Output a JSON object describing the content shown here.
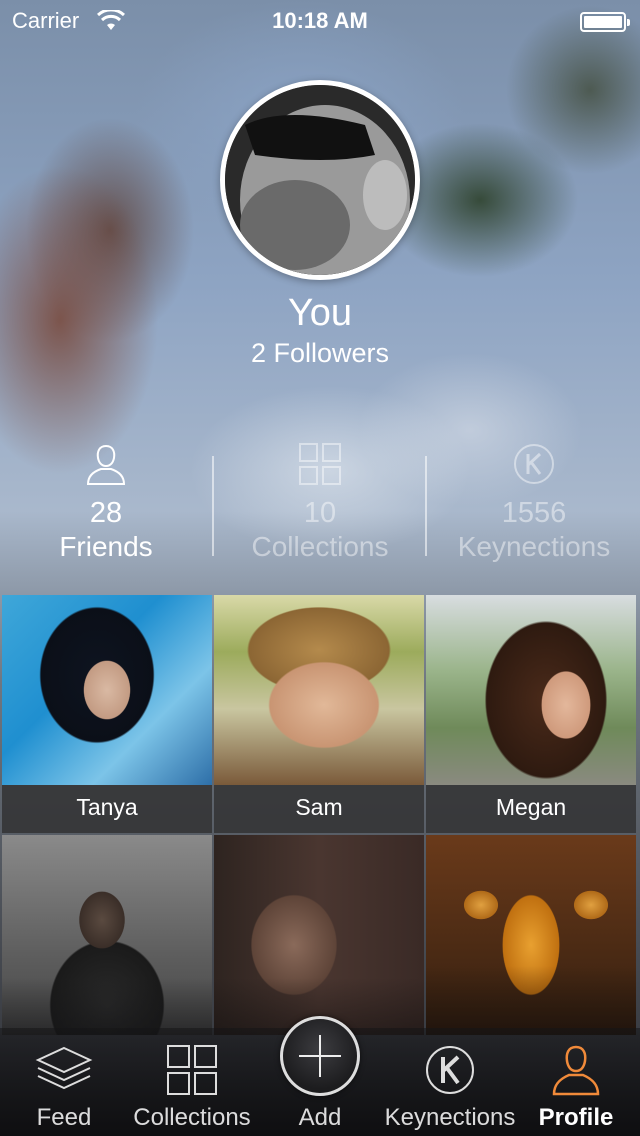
{
  "status_bar": {
    "carrier": "Carrier",
    "time": "10:18 AM"
  },
  "profile": {
    "name": "You",
    "followers": "2 Followers"
  },
  "stats": [
    {
      "value": "28",
      "label": "Friends",
      "icon": "person-icon"
    },
    {
      "value": "10",
      "label": "Collections",
      "icon": "grid-icon"
    },
    {
      "value": "1556",
      "label": "Keynections",
      "icon": "keynections-k-icon"
    }
  ],
  "friends": [
    {
      "name": "Tanya"
    },
    {
      "name": "Sam"
    },
    {
      "name": "Megan"
    }
  ],
  "tab_bar": {
    "tabs": [
      {
        "label": "Feed",
        "icon": "layers-icon"
      },
      {
        "label": "Collections",
        "icon": "grid-icon"
      },
      {
        "label": "Add",
        "icon": "plus-icon"
      },
      {
        "label": "Keynections",
        "icon": "keynections-k-icon"
      },
      {
        "label": "Profile",
        "icon": "person-icon"
      }
    ],
    "active": "Profile"
  },
  "colors": {
    "accent": "#f08a3a",
    "tab_bar_bg": "#0c0c0e",
    "caption_bg": "#323234"
  }
}
